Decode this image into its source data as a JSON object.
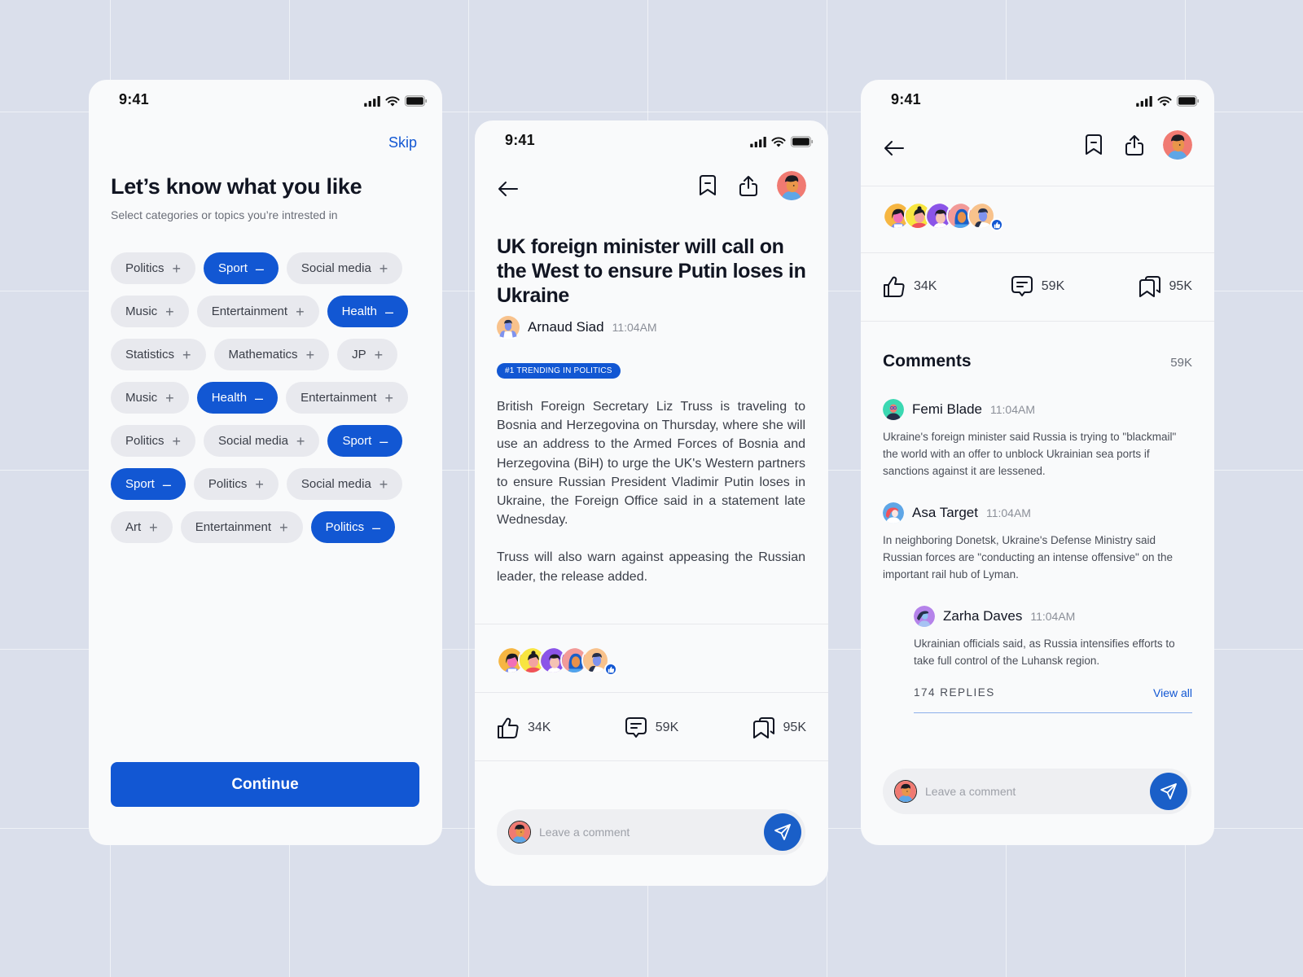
{
  "status_bar": {
    "time": "9:41"
  },
  "onboarding": {
    "skip_label": "Skip",
    "title": "Let’s know what you like",
    "subtitle": "Select categories or topics you’re intrested in",
    "topic_rows": [
      [
        {
          "label": "Politics",
          "selected": false
        },
        {
          "label": "Sport",
          "selected": true
        },
        {
          "label": "Social media",
          "selected": false
        }
      ],
      [
        {
          "label": "Music",
          "selected": false
        },
        {
          "label": "Entertainment",
          "selected": false
        },
        {
          "label": "Health",
          "selected": true
        }
      ],
      [
        {
          "label": "Statistics",
          "selected": false
        },
        {
          "label": "Mathematics",
          "selected": false
        },
        {
          "label": "JP",
          "selected": false
        }
      ],
      [
        {
          "label": "Music",
          "selected": false
        },
        {
          "label": "Health",
          "selected": true
        },
        {
          "label": "Entertainment",
          "selected": false
        }
      ],
      [
        {
          "label": "Politics",
          "selected": false
        },
        {
          "label": "Social media",
          "selected": false
        },
        {
          "label": "Sport",
          "selected": true
        }
      ],
      [
        {
          "label": "Sport",
          "selected": true
        },
        {
          "label": "Politics",
          "selected": false
        },
        {
          "label": "Social media",
          "selected": false
        }
      ],
      [
        {
          "label": "Art",
          "selected": false
        },
        {
          "label": "Entertainment",
          "selected": false
        },
        {
          "label": "Politics",
          "selected": true
        }
      ]
    ],
    "add_symbol": "+",
    "remove_symbol": "–",
    "continue_label": "Continue"
  },
  "article": {
    "title": "UK foreign minister will call on the West to ensure Putin loses in Ukraine",
    "author": "Arnaud Siad",
    "time": "11:04AM",
    "badge": "#1 TRENDING IN POLITICS",
    "paragraphs": [
      "British Foreign Secretary Liz Truss is traveling to Bosnia and Herzegovina on Thursday, where she will use an address to the Armed Forces of Bosnia and Herzegovina (BiH) to urge the UK's Western partners to ensure Russian President Vladimir Putin loses in Ukraine, the Foreign Office said in a statement late Wednesday.",
      "Truss will also warn against appeasing the Russian leader, the release added."
    ],
    "stats": {
      "likes": "34K",
      "comments": "59K",
      "saves": "95K"
    },
    "comment_placeholder": "Leave a comment"
  },
  "comments_screen": {
    "stats": {
      "likes": "34K",
      "comments": "59K",
      "saves": "95K"
    },
    "heading": "Comments",
    "count": "59K",
    "comments": [
      {
        "name": "Femi Blade",
        "time": "11:04AM",
        "text": "Ukraine's foreign minister said Russia is trying to \"blackmail\" the world with an offer to unblock Ukrainian sea ports if sanctions against it are lessened."
      },
      {
        "name": "Asa Target",
        "time": "11:04AM",
        "text": "In neighboring Donetsk, Ukraine's Defense Ministry said Russian forces are \"conducting an intense offensive\" on the important rail hub of Lyman."
      },
      {
        "name": "Zarha Daves",
        "time": "11:04AM",
        "text": "Ukrainian officials said, as Russia intensifies efforts to take full control of the Luhansk region."
      }
    ],
    "replies_label": "174 REPLIES",
    "view_all_label": "View all",
    "comment_placeholder": "Leave a comment"
  },
  "colors": {
    "accent": "#1257d3",
    "background": "#dadfeb",
    "card": "#f9fafb",
    "chip": "#e8e9ee"
  }
}
